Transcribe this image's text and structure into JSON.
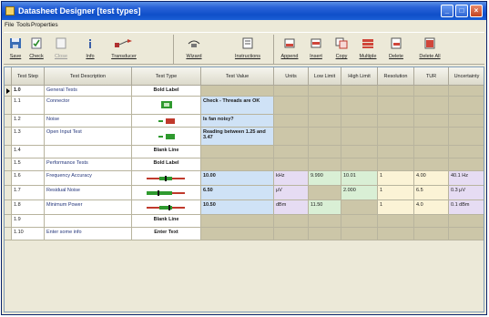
{
  "window": {
    "title": "Datasheet Designer [test types]"
  },
  "colors": {
    "title_bar": "#1b5fd6",
    "header_bg": "#e6e4d5",
    "row_tan": "#ccc6a8",
    "value_blue": "#cfe2f6",
    "low_green": "#d9efd5",
    "res_yellow": "#fbf3d6",
    "unc_violet": "#e6dcf3"
  },
  "menubar": {
    "items": [
      "File",
      "Tools",
      "Properties"
    ]
  },
  "toolbar": {
    "buttons": [
      {
        "label": "Save",
        "icon": "save-icon"
      },
      {
        "label": "Check",
        "icon": "check-icon"
      },
      {
        "label": "Close",
        "icon": "close-doc-icon"
      },
      {
        "label": "Info",
        "icon": "info-icon"
      },
      {
        "label": "Transducer",
        "icon": "transducer-icon"
      },
      {
        "label": "Wizard",
        "icon": "wizard-icon"
      },
      {
        "label": "Instructions",
        "icon": "instructions-icon"
      },
      {
        "label": "Append",
        "icon": "append-icon"
      },
      {
        "label": "Insert",
        "icon": "insert-icon"
      },
      {
        "label": "Copy",
        "icon": "copy-icon"
      },
      {
        "label": "Multiple",
        "icon": "multiple-icon"
      },
      {
        "label": "Delete",
        "icon": "delete-icon"
      },
      {
        "label": "Delete All",
        "icon": "delete-all-icon"
      }
    ]
  },
  "grid": {
    "columns": [
      "Test Step",
      "Test Description",
      "Test Type",
      "Test Value",
      "Units",
      "Low Limit",
      "High Limit",
      "Resolution",
      "TUR",
      "Uncertainty"
    ],
    "rows": [
      {
        "step": "1.0",
        "desc": "General Tests",
        "type": "Bold Label",
        "value": "",
        "units": "",
        "low": "",
        "high": "",
        "res": "",
        "tur": "",
        "unc": ""
      },
      {
        "step": "1.1",
        "desc": "Connector",
        "type": "check-yes",
        "value": "Check - Threads are OK",
        "units": "",
        "low": "",
        "high": "",
        "res": "",
        "tur": "",
        "unc": ""
      },
      {
        "step": "1.2",
        "desc": "Noise",
        "type": "yes-no",
        "value": "Is fan noisy?",
        "units": "",
        "low": "",
        "high": "",
        "res": "",
        "tur": "",
        "unc": ""
      },
      {
        "step": "1.3",
        "desc": "Open Input Test",
        "type": "yes-no-green",
        "value": "Reading between 1.25 and 3.47",
        "units": "",
        "low": "",
        "high": "",
        "res": "",
        "tur": "",
        "unc": ""
      },
      {
        "step": "1.4",
        "desc": "",
        "type": "Blank Line",
        "value": "",
        "units": "",
        "low": "",
        "high": "",
        "res": "",
        "tur": "",
        "unc": ""
      },
      {
        "step": "1.5",
        "desc": "Performance Tests",
        "type": "Bold Label",
        "value": "",
        "units": "",
        "low": "",
        "high": "",
        "res": "",
        "tur": "",
        "unc": ""
      },
      {
        "step": "1.6",
        "desc": "Frequency Accuracy",
        "type": "limits",
        "value": "10.00",
        "units": "kHz",
        "low": "9.990",
        "high": "10.01",
        "res": "1",
        "tur": "4.00",
        "unc": "40.1 Hz"
      },
      {
        "step": "1.7",
        "desc": "Residual Noise",
        "type": "limits-green",
        "value": "6.50",
        "units": "μV",
        "low": "",
        "high": "2.000",
        "res": "1",
        "tur": "6.5",
        "unc": "0.3 μV"
      },
      {
        "step": "1.8",
        "desc": "Minimum Power",
        "type": "limits",
        "value": "10.50",
        "units": "dBm",
        "low": "11.50",
        "high": "",
        "res": "1",
        "tur": "4.0",
        "unc": "0.1 dBm"
      },
      {
        "step": "1.9",
        "desc": "",
        "type": "Blank Line",
        "value": "",
        "units": "",
        "low": "",
        "high": "",
        "res": "",
        "tur": "",
        "unc": ""
      },
      {
        "step": "1.10",
        "desc": "Enter some info",
        "type": "Enter Text",
        "value": "",
        "units": "",
        "low": "",
        "high": "",
        "res": "",
        "tur": "",
        "unc": ""
      }
    ]
  }
}
